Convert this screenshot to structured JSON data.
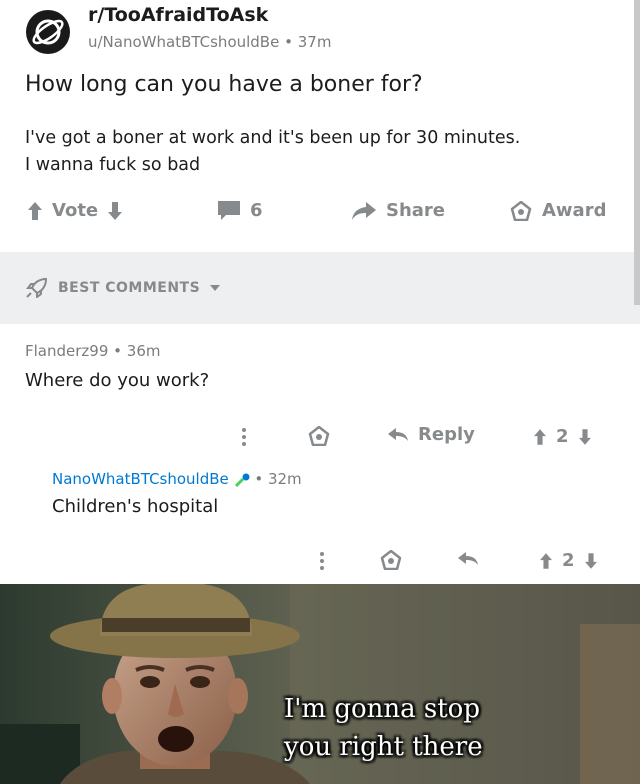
{
  "post": {
    "subreddit": "r/TooAfraidToAsk",
    "author": "u/NanoWhatBTCshouldBe",
    "age": "37m",
    "title": "How long can you have a boner for?",
    "body_lines": [
      "I've got a boner at work and it's been up for 30 minutes.",
      "I wanna fuck so bad"
    ],
    "actions": {
      "vote_label": "Vote",
      "comment_count": "6",
      "share_label": "Share",
      "award_label": "Award"
    }
  },
  "sort": {
    "label": "BEST COMMENTS"
  },
  "comments": [
    {
      "author": "Flanderz99",
      "age": "36m",
      "text": "Where do you work?",
      "reply_label": "Reply",
      "score": "2"
    },
    {
      "author": "NanoWhatBTCshouldBe",
      "age": "32m",
      "text": "Children's hospital",
      "score": "2"
    }
  ],
  "meme": {
    "caption_lines": [
      "I'm gonna stop",
      "you right there"
    ]
  },
  "colors": {
    "muted": "#878a8c",
    "op_author": "#0079d3",
    "sort_bg": "#edeff1"
  }
}
